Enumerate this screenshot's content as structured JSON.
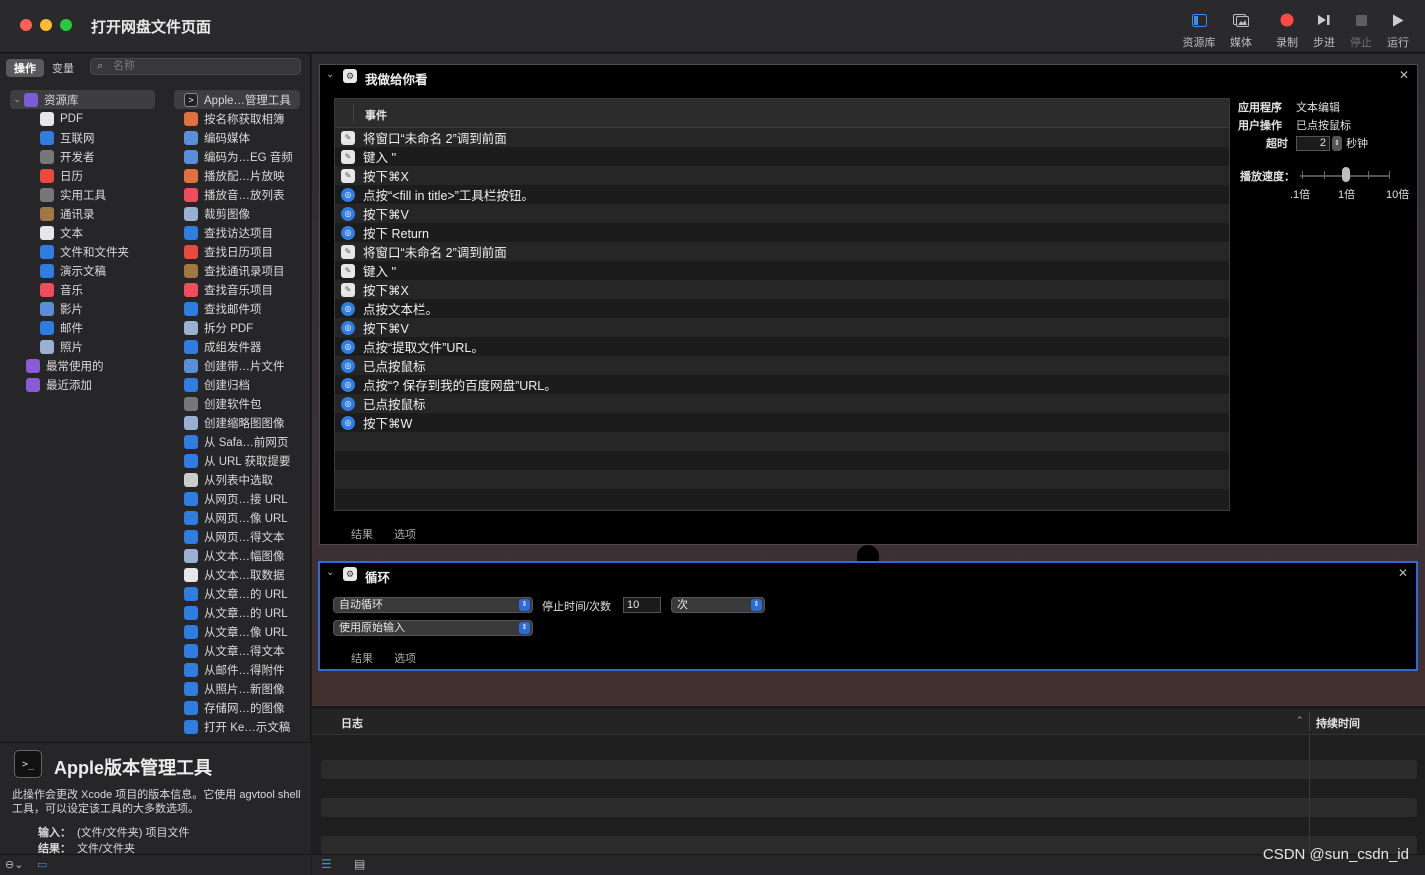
{
  "window": {
    "title": "打开网盘文件页面"
  },
  "toolbar": {
    "library": "资源库",
    "media": "媒体",
    "record": "录制",
    "step": "步进",
    "stop": "停止",
    "run": "运行"
  },
  "sidebar": {
    "tab_actions": "操作",
    "tab_variables": "变量",
    "search_placeholder": "名称",
    "categories": [
      {
        "label": "资源库",
        "icon": "library-icon",
        "color": "#7b5bd6"
      },
      {
        "label": "PDF",
        "icon": "pdf-icon",
        "color": "#e6e6e6"
      },
      {
        "label": "互联网",
        "icon": "globe-icon",
        "color": "#2f7de1"
      },
      {
        "label": "开发者",
        "icon": "tools-icon",
        "color": "#777777"
      },
      {
        "label": "日历",
        "icon": "calendar-icon",
        "color": "#e84a3f"
      },
      {
        "label": "实用工具",
        "icon": "utilities-icon",
        "color": "#777777"
      },
      {
        "label": "通讯录",
        "icon": "contacts-icon",
        "color": "#a07844"
      },
      {
        "label": "文本",
        "icon": "text-icon",
        "color": "#e6e6e6"
      },
      {
        "label": "文件和文件夹",
        "icon": "finder-icon",
        "color": "#2f7de1"
      },
      {
        "label": "演示文稿",
        "icon": "keynote-icon",
        "color": "#2f7de1"
      },
      {
        "label": "音乐",
        "icon": "music-icon",
        "color": "#f04c5e"
      },
      {
        "label": "影片",
        "icon": "movie-icon",
        "color": "#5a8fd8"
      },
      {
        "label": "邮件",
        "icon": "mail-icon",
        "color": "#2f7de1"
      },
      {
        "label": "照片",
        "icon": "photo-icon",
        "color": "#9ab0d0"
      },
      {
        "label": "最常使用的",
        "icon": "smart-folder-icon",
        "color": "#8a5bd6"
      },
      {
        "label": "最近添加",
        "icon": "smart-folder-icon",
        "color": "#8a5bd6"
      }
    ],
    "actions": [
      {
        "label": "Apple…管理工具",
        "icon": "terminal-icon",
        "color": "#222222"
      },
      {
        "label": "按名称获取相簿",
        "icon": "photos-icon",
        "color": "#e07040"
      },
      {
        "label": "编码媒体",
        "icon": "quicktime-icon",
        "color": "#5a8fd8"
      },
      {
        "label": "编码为…EG 音频",
        "icon": "quicktime-icon",
        "color": "#5a8fd8"
      },
      {
        "label": "播放配…片放映",
        "icon": "photos-icon",
        "color": "#e07040"
      },
      {
        "label": "播放音…放列表",
        "icon": "music-icon",
        "color": "#f04c5e"
      },
      {
        "label": "裁剪图像",
        "icon": "preview-icon",
        "color": "#9ab0d0"
      },
      {
        "label": "查找访达项目",
        "icon": "finder-icon",
        "color": "#2f7de1"
      },
      {
        "label": "查找日历项目",
        "icon": "calendar-icon",
        "color": "#e84a3f"
      },
      {
        "label": "查找通讯录项目",
        "icon": "contacts-icon",
        "color": "#a07844"
      },
      {
        "label": "查找音乐项目",
        "icon": "music-icon",
        "color": "#f04c5e"
      },
      {
        "label": "查找邮件项",
        "icon": "mail-icon",
        "color": "#2f7de1"
      },
      {
        "label": "拆分 PDF",
        "icon": "preview-icon",
        "color": "#9ab0d0"
      },
      {
        "label": "成组发件器",
        "icon": "mail-icon",
        "color": "#2f7de1"
      },
      {
        "label": "创建带…片文件",
        "icon": "quicktime-icon",
        "color": "#5a8fd8"
      },
      {
        "label": "创建归档",
        "icon": "finder-icon",
        "color": "#2f7de1"
      },
      {
        "label": "创建软件包",
        "icon": "tools-icon",
        "color": "#777777"
      },
      {
        "label": "创建缩略图图像",
        "icon": "preview-icon",
        "color": "#9ab0d0"
      },
      {
        "label": "从 Safa…前网页",
        "icon": "safari-icon",
        "color": "#2f7de1"
      },
      {
        "label": "从 URL 获取提要",
        "icon": "safari-icon",
        "color": "#2f7de1"
      },
      {
        "label": "从列表中选取",
        "icon": "automator-icon",
        "color": "#cccccc"
      },
      {
        "label": "从网页…接 URL",
        "icon": "safari-icon",
        "color": "#2f7de1"
      },
      {
        "label": "从网页…像 URL",
        "icon": "safari-icon",
        "color": "#2f7de1"
      },
      {
        "label": "从网页…得文本",
        "icon": "safari-icon",
        "color": "#2f7de1"
      },
      {
        "label": "从文本…幅图像",
        "icon": "preview-icon",
        "color": "#9ab0d0"
      },
      {
        "label": "从文本…取数据",
        "icon": "text-icon",
        "color": "#e6e6e6"
      },
      {
        "label": "从文章…的 URL",
        "icon": "safari-icon",
        "color": "#2f7de1"
      },
      {
        "label": "从文章…的 URL",
        "icon": "safari-icon",
        "color": "#2f7de1"
      },
      {
        "label": "从文章…像 URL",
        "icon": "safari-icon",
        "color": "#2f7de1"
      },
      {
        "label": "从文章…得文本",
        "icon": "safari-icon",
        "color": "#2f7de1"
      },
      {
        "label": "从邮件…得附件",
        "icon": "mail-icon",
        "color": "#2f7de1"
      },
      {
        "label": "从照片…新图像",
        "icon": "keynote-icon",
        "color": "#2f7de1"
      },
      {
        "label": "存储网…的图像",
        "icon": "safari-icon",
        "color": "#2f7de1"
      },
      {
        "label": "打开 Ke…示文稿",
        "icon": "keynote-icon",
        "color": "#2f7de1"
      }
    ],
    "description": {
      "title": "Apple版本管理工具",
      "text": "此操作会更改 Xcode 项目的版本信息。它使用 agvtool shell 工具，可以设定该工具的大多数选项。",
      "input_label": "输入：",
      "input_value": "(文件/文件夹) 项目文件",
      "result_label": "结果：",
      "result_value": "文件/文件夹"
    }
  },
  "watch_me": {
    "title": "我做给你看",
    "column_header": "事件",
    "events": [
      {
        "text": "将窗口“未命名 2”调到前面",
        "app": "textedit"
      },
      {
        "text": "键入 ''",
        "app": "textedit"
      },
      {
        "text": "按下⌘X",
        "app": "textedit"
      },
      {
        "text": "点按“<fill in title>”工具栏按钮。",
        "app": "safari"
      },
      {
        "text": "按下⌘V",
        "app": "safari"
      },
      {
        "text": "按下 Return",
        "app": "safari"
      },
      {
        "text": "将窗口“未命名 2”调到前面",
        "app": "textedit"
      },
      {
        "text": "键入 ''",
        "app": "textedit"
      },
      {
        "text": "按下⌘X",
        "app": "textedit"
      },
      {
        "text": "点按文本栏。",
        "app": "safari"
      },
      {
        "text": "按下⌘V",
        "app": "safari"
      },
      {
        "text": "点按“提取文件”URL。",
        "app": "safari"
      },
      {
        "text": "已点按鼠标",
        "app": "safari"
      },
      {
        "text": "点按“? 保存到我的百度网盘”URL。",
        "app": "safari"
      },
      {
        "text": "已点按鼠标",
        "app": "safari"
      },
      {
        "text": "按下⌘W",
        "app": "safari"
      }
    ],
    "tab_results": "结果",
    "tab_options": "选项",
    "props": {
      "app_label": "应用程序",
      "app_value": "文本编辑",
      "user_action_label": "用户操作",
      "user_action_value": "已点按鼠标",
      "timeout_label": "超时",
      "timeout_value": "2",
      "timeout_unit": "秒钟",
      "speed_label": "播放速度：",
      "speed_min": ".1倍",
      "speed_mid": "1倍",
      "speed_max": "10倍",
      "speed_value": 1
    }
  },
  "loop": {
    "title": "循环",
    "mode": "自动循环",
    "stop_label": "停止时间/次数",
    "count": "10",
    "unit": "次",
    "input_mode": "使用原始输入",
    "tab_results": "结果",
    "tab_options": "选项"
  },
  "log": {
    "col_log": "日志",
    "col_duration": "持续时间"
  },
  "watermark": "CSDN @sun_csdn_id"
}
